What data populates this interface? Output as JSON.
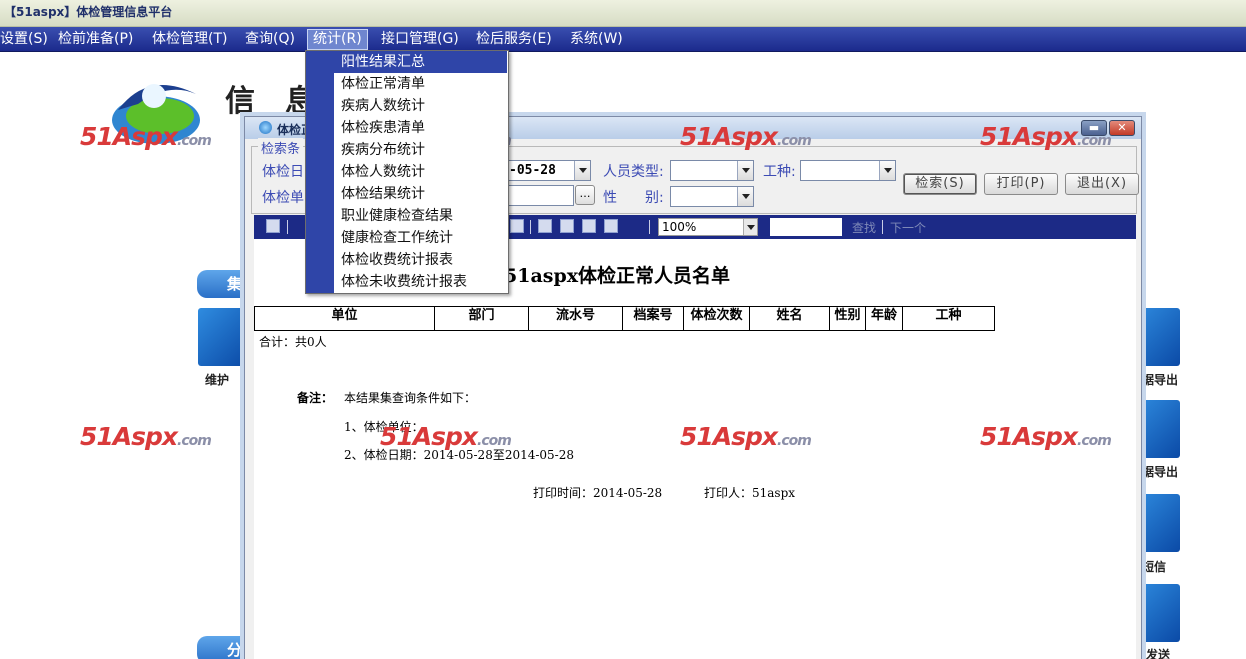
{
  "app": {
    "title": "【51aspx】体检管理信息平台"
  },
  "menubar": [
    {
      "label": "设置(S)"
    },
    {
      "label": "检前准备(P)"
    },
    {
      "label": "体检管理(T)"
    },
    {
      "label": "查询(Q)"
    },
    {
      "label": "统计(R)"
    },
    {
      "label": "接口管理(G)"
    },
    {
      "label": "检后服务(E)"
    },
    {
      "label": "系统(W)"
    }
  ],
  "stats_menu": {
    "items": [
      {
        "label": "阳性结果汇总"
      },
      {
        "label": "体检正常清单"
      },
      {
        "label": "疾病人数统计"
      },
      {
        "label": "体检疾患清单"
      },
      {
        "label": "疾病分布统计"
      },
      {
        "label": "体检人数统计"
      },
      {
        "label": "体检结果统计"
      },
      {
        "label": "职业健康检查结果"
      },
      {
        "label": "健康检查工作统计"
      },
      {
        "label": "体检收费统计报表"
      },
      {
        "label": "体检未收费统计报表"
      }
    ]
  },
  "background": {
    "title_chars": [
      "信",
      "息"
    ],
    "watermark": {
      "main": "51Aspx",
      "domain": ".com"
    },
    "tabs": [
      "集",
      "分"
    ],
    "icon_labels": [
      "维护",
      "据导出",
      "据导出",
      "短信",
      "发送"
    ]
  },
  "window": {
    "title": "体检正",
    "criteria": {
      "legend": "检索条",
      "date_label": "体检日",
      "date_value": "-05-28",
      "unit_label": "体检单",
      "person_type_label": "人员类型:",
      "job_label": "工种:",
      "gender_label": "性　　别:",
      "search_button": "检索(S)",
      "print_button": "打印(P)",
      "exit_button": "退出(X)"
    },
    "toolbar": {
      "zoom": "100%",
      "find_label": "查找",
      "next_label": "下一个"
    },
    "report": {
      "title": "51aspx体检正常人员名单",
      "columns": [
        "单位",
        "部门",
        "流水号",
        "档案号",
        "体检次数",
        "姓名",
        "性别",
        "年龄",
        "工种"
      ],
      "total": "合计：共0人",
      "note_label": "备注：",
      "note_text": "本结果集查询条件如下：",
      "cond1": "1、体检单位：",
      "cond2": "2、体检日期：2014-05-28至2014-05-28",
      "print_time": "打印时间：2014-05-28",
      "printer": "打印人：51aspx"
    }
  }
}
